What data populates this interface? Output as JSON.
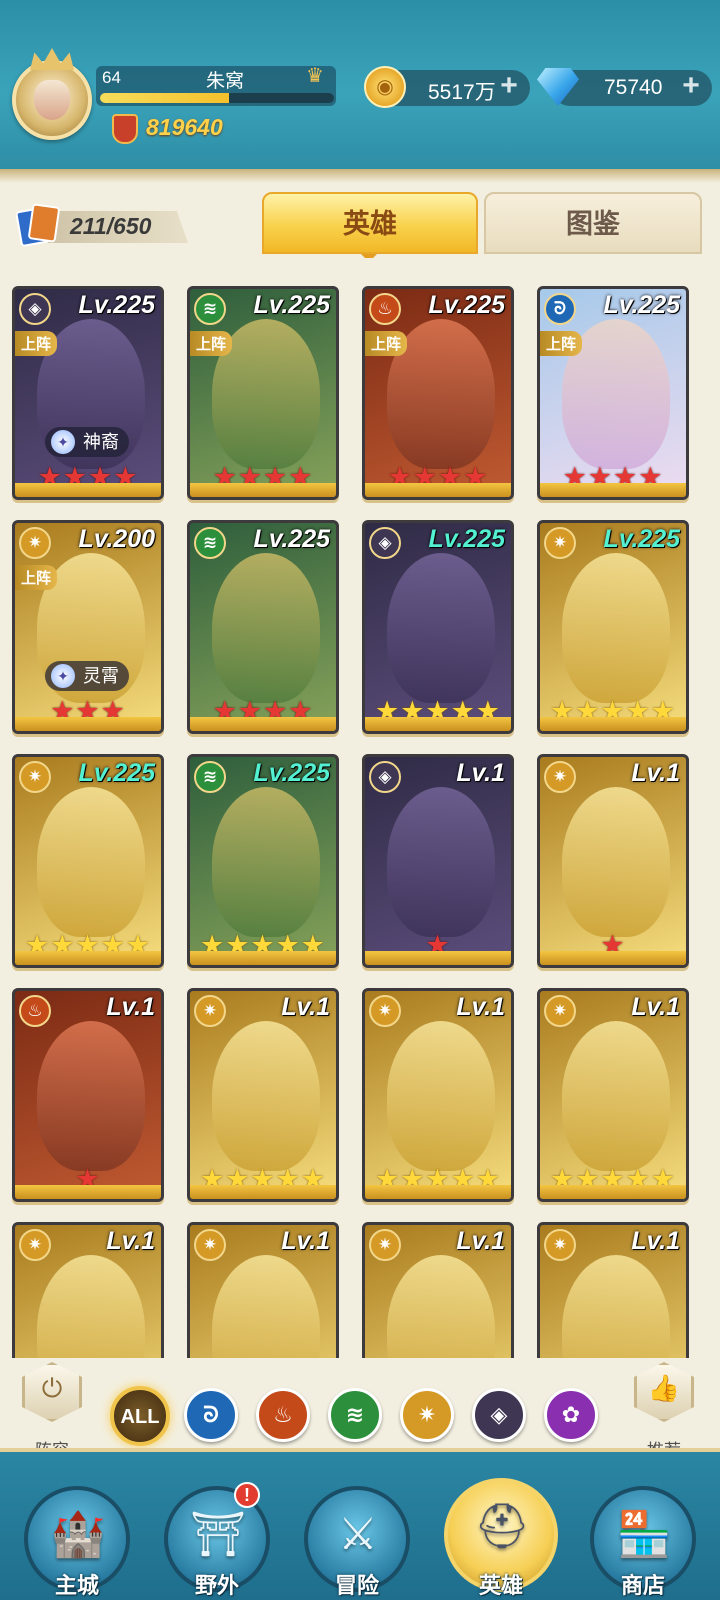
{
  "player": {
    "level": "64",
    "name": "朱窝",
    "exp_progress": 0.55,
    "power": "819640"
  },
  "resources": {
    "gold": "5517万",
    "diamonds": "75740"
  },
  "collection": {
    "count": "211/650"
  },
  "tabs": {
    "heroes": "英雄",
    "codex": "图鉴"
  },
  "heroes": [
    {
      "faction": "dark",
      "level": "Lv.225",
      "deployed": "上阵",
      "tag": "神裔",
      "stars": "★★★★",
      "star_color": "red",
      "lv_color": "white"
    },
    {
      "faction": "wind",
      "level": "Lv.225",
      "deployed": "上阵",
      "tag": "",
      "stars": "★★★★",
      "star_color": "red",
      "lv_color": "white"
    },
    {
      "faction": "fire",
      "level": "Lv.225",
      "deployed": "上阵",
      "tag": "",
      "stars": "★★★★",
      "star_color": "red",
      "lv_color": "white"
    },
    {
      "faction": "water",
      "level": "Lv.225",
      "deployed": "上阵",
      "tag": "",
      "stars": "★★★★",
      "star_color": "red",
      "lv_color": "white"
    },
    {
      "faction": "light",
      "level": "Lv.200",
      "deployed": "上阵",
      "tag": "灵霄",
      "stars": "★★★",
      "star_color": "red",
      "lv_color": "white"
    },
    {
      "faction": "wind",
      "level": "Lv.225",
      "deployed": "",
      "tag": "",
      "stars": "★★★★",
      "star_color": "red",
      "lv_color": "white"
    },
    {
      "faction": "dark",
      "level": "Lv.225",
      "deployed": "",
      "tag": "",
      "stars": "★★★★★",
      "star_color": "gold",
      "lv_color": "cyan"
    },
    {
      "faction": "light",
      "level": "Lv.225",
      "deployed": "",
      "tag": "",
      "stars": "★★★★★",
      "star_color": "gold",
      "lv_color": "cyan"
    },
    {
      "faction": "light",
      "level": "Lv.225",
      "deployed": "",
      "tag": "",
      "stars": "★★★★★",
      "star_color": "gold",
      "lv_color": "cyan"
    },
    {
      "faction": "wind",
      "level": "Lv.225",
      "deployed": "",
      "tag": "",
      "stars": "★★★★★",
      "star_color": "gold",
      "lv_color": "cyan"
    },
    {
      "faction": "dark",
      "level": "Lv.1",
      "deployed": "",
      "tag": "",
      "stars": "★",
      "star_color": "red",
      "lv_color": "white"
    },
    {
      "faction": "light",
      "level": "Lv.1",
      "deployed": "",
      "tag": "",
      "stars": "★",
      "star_color": "red",
      "lv_color": "white"
    },
    {
      "faction": "fire",
      "level": "Lv.1",
      "deployed": "",
      "tag": "",
      "stars": "★",
      "star_color": "red",
      "lv_color": "white"
    },
    {
      "faction": "light",
      "level": "Lv.1",
      "deployed": "",
      "tag": "",
      "stars": "★★★★★",
      "star_color": "gold",
      "lv_color": "white"
    },
    {
      "faction": "light",
      "level": "Lv.1",
      "deployed": "",
      "tag": "",
      "stars": "★★★★★",
      "star_color": "gold",
      "lv_color": "white"
    },
    {
      "faction": "light",
      "level": "Lv.1",
      "deployed": "",
      "tag": "",
      "stars": "★★★★★",
      "star_color": "gold",
      "lv_color": "white"
    },
    {
      "faction": "light",
      "level": "Lv.1",
      "deployed": "",
      "tag": "",
      "stars": "",
      "star_color": "gold",
      "lv_color": "white"
    },
    {
      "faction": "light",
      "level": "Lv.1",
      "deployed": "",
      "tag": "",
      "stars": "",
      "star_color": "gold",
      "lv_color": "white"
    },
    {
      "faction": "light",
      "level": "Lv.1",
      "deployed": "",
      "tag": "",
      "stars": "",
      "star_color": "gold",
      "lv_color": "white"
    },
    {
      "faction": "light",
      "level": "Lv.1",
      "deployed": "",
      "tag": "",
      "stars": "",
      "star_color": "gold",
      "lv_color": "white"
    }
  ],
  "filters": {
    "lineup_label": "阵容",
    "recommend_label": "推荐",
    "all_label": "ALL",
    "factions": [
      "water",
      "fire",
      "wind",
      "light",
      "dark",
      "void"
    ]
  },
  "nav": {
    "items": [
      {
        "label": "主城",
        "icon": "castle-icon"
      },
      {
        "label": "野外",
        "icon": "portal-icon",
        "badge": "!"
      },
      {
        "label": "冒险",
        "icon": "sword-icon"
      },
      {
        "label": "英雄",
        "icon": "helmet-icon"
      },
      {
        "label": "商店",
        "icon": "shop-icon"
      }
    ]
  },
  "colors": {
    "header": "#3aa3ba",
    "accent_gold": "#f1b827",
    "star_red": "#e53835",
    "star_gold": "#ffd93a"
  }
}
